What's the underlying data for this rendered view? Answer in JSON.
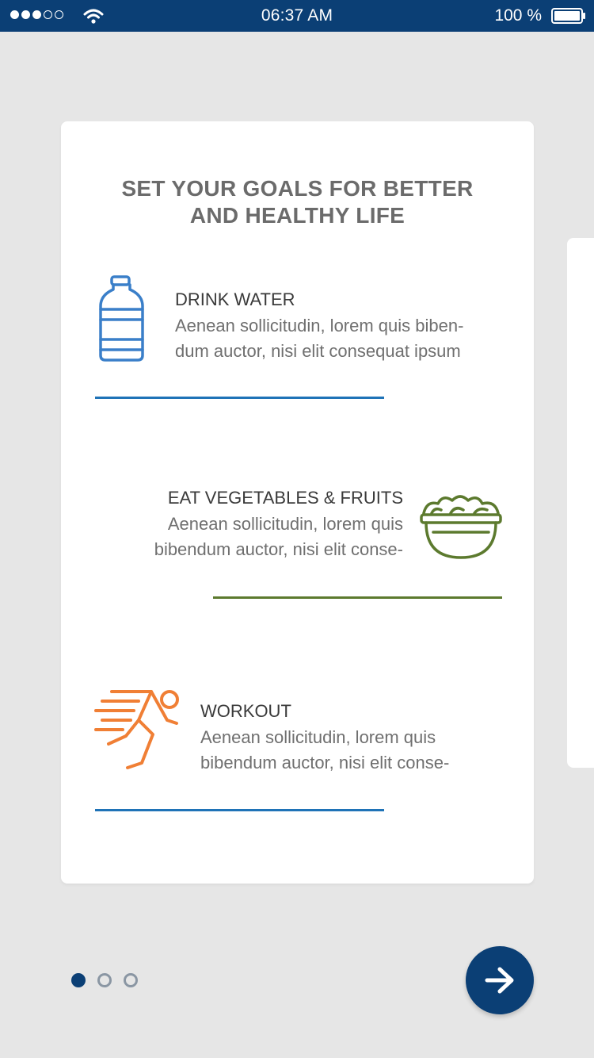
{
  "status_bar": {
    "time": "06:37 AM",
    "battery": "100 %",
    "signal_dots": [
      true,
      true,
      true,
      false,
      false
    ],
    "icons": [
      "wifi-icon",
      "battery-icon"
    ]
  },
  "card": {
    "title_line1": "SET YOUR GOALS FOR BETTER",
    "title_line2": "AND HEALTHY LIFE",
    "goals": [
      {
        "title": "DRINK WATER",
        "desc_line1": "Aenean sollicitudin, lorem quis biben-",
        "desc_line2": "dum auctor, nisi elit consequat ipsum",
        "icon": "water-bottle-icon",
        "color": "#3a7fc9"
      },
      {
        "title": "EAT VEGETABLES & FRUITS",
        "desc_line1": "Aenean sollicitudin, lorem quis",
        "desc_line2": "bibendum auctor, nisi elit conse-",
        "icon": "salad-bowl-icon",
        "color": "#5c7a2e"
      },
      {
        "title": "WORKOUT",
        "desc_line1": "Aenean sollicitudin, lorem quis",
        "desc_line2": "bibendum auctor, nisi elit conse-",
        "icon": "running-man-icon",
        "color": "#f07f35"
      }
    ]
  },
  "pagination": {
    "total": 3,
    "active": 1
  },
  "next_button": {
    "icon": "arrow-right-icon"
  },
  "colors": {
    "primary": "#0b3f75",
    "divider_blue": "#1f73b7",
    "divider_green": "#5c7a2e",
    "background": "#e6e6e6"
  }
}
